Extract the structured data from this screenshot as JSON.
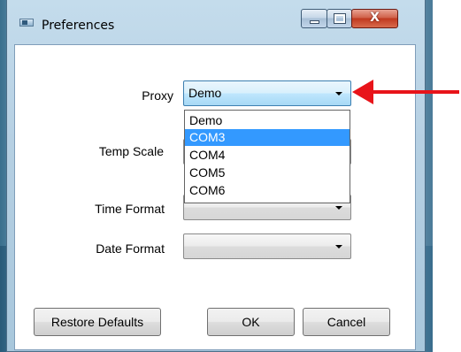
{
  "window": {
    "title": "Preferences",
    "icon": "app-window-icon",
    "controls": {
      "minimize": "minimize-icon",
      "maximize": "maximize-icon",
      "close_glyph": "X"
    }
  },
  "fields": {
    "proxy": {
      "label": "Proxy",
      "value": "Demo"
    },
    "temp_scale": {
      "label": "Temp Scale",
      "value": ""
    },
    "time_format": {
      "label": "Time Format",
      "value": ""
    },
    "date_format": {
      "label": "Date Format",
      "value": ""
    }
  },
  "proxy_dropdown": {
    "options": [
      "Demo",
      "COM3",
      "COM4",
      "COM5",
      "COM6"
    ],
    "highlighted_index": 1
  },
  "buttons": {
    "restore_defaults": "Restore Defaults",
    "ok": "OK",
    "cancel": "Cancel"
  },
  "annotation": {
    "arrow_color": "#e8141a"
  },
  "colors": {
    "selection": "#3399ff",
    "close_button": "#c0391f"
  }
}
